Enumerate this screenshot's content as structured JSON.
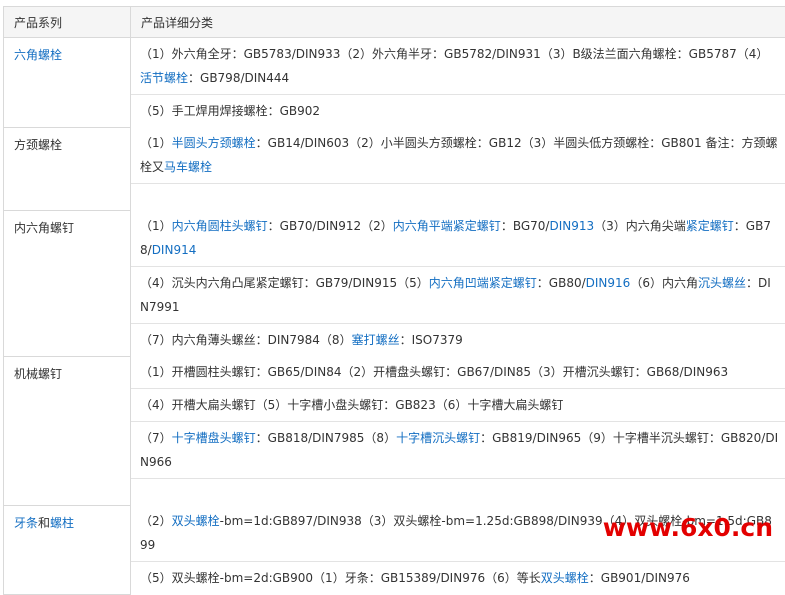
{
  "headers": {
    "series": "产品系列",
    "detail": "产品详细分类"
  },
  "rows": [
    {
      "label": "六角螺栓",
      "label_parts": [
        {
          "text": "六角螺栓",
          "link": true
        }
      ],
      "cells": [
        [
          {
            "t": "（1）外六角全牙：GB5783/DIN933（2）外六角半牙：GB5782/DIN931（3）B级法兰面六角螺栓：GB5787（4）",
            "l": false
          },
          {
            "t": "活节螺栓",
            "l": true
          },
          {
            "t": "：GB798/DIN444",
            "l": false
          }
        ],
        [
          {
            "t": "（5）手工焊用焊接螺栓：GB902",
            "l": false
          }
        ]
      ]
    },
    {
      "label": "方颈螺栓",
      "label_parts": [
        {
          "text": "方颈螺栓",
          "link": false
        }
      ],
      "cells": [
        [
          {
            "t": "（1）",
            "l": false
          },
          {
            "t": "半圆头方颈螺栓",
            "l": true
          },
          {
            "t": "：GB14/DIN603（2）小半圆头方颈螺栓：GB12（3）半圆头低方颈螺栓：GB801 备注：方颈螺栓又",
            "l": false
          },
          {
            "t": "马车螺栓",
            "l": true
          }
        ],
        []
      ]
    },
    {
      "label": "内六角螺钉",
      "label_parts": [
        {
          "text": "内六角螺钉",
          "link": false
        }
      ],
      "cells": [
        [
          {
            "t": "（1）",
            "l": false
          },
          {
            "t": "内六角圆柱头螺钉",
            "l": true
          },
          {
            "t": "：GB70/DIN912（2）",
            "l": false
          },
          {
            "t": "内六角平端紧定螺钉",
            "l": true
          },
          {
            "t": "：BG70/",
            "l": false
          },
          {
            "t": "DIN913",
            "l": true
          },
          {
            "t": "（3）内六角尖端",
            "l": false
          },
          {
            "t": "紧定螺钉",
            "l": true
          },
          {
            "t": "：GB78/",
            "l": false
          },
          {
            "t": "DIN914",
            "l": true
          }
        ],
        [
          {
            "t": "（4）沉头内六角凸尾紧定螺钉：GB79/DIN915（5）",
            "l": false
          },
          {
            "t": "内六角凹端紧定螺钉",
            "l": true
          },
          {
            "t": "：GB80/",
            "l": false
          },
          {
            "t": "DIN916",
            "l": true
          },
          {
            "t": "（6）内六角",
            "l": false
          },
          {
            "t": "沉头螺丝",
            "l": true
          },
          {
            "t": "：DIN7991",
            "l": false
          }
        ],
        [
          {
            "t": "（7）内六角薄头螺丝：DIN7984（8）",
            "l": false
          },
          {
            "t": "塞打螺丝",
            "l": true
          },
          {
            "t": "：ISO7379",
            "l": false
          }
        ]
      ]
    },
    {
      "label": "机械螺钉",
      "label_parts": [
        {
          "text": "机械螺钉",
          "link": false
        }
      ],
      "cells": [
        [
          {
            "t": "（1）开槽圆柱头螺钉：GB65/DIN84（2）开槽盘头螺钉：GB67/DIN85（3）开槽沉头螺钉：GB68/DIN963",
            "l": false
          }
        ],
        [
          {
            "t": "（4）开槽大扁头螺钉（5）十字槽小盘头螺钉：GB823（6）十字槽大扁头螺钉",
            "l": false
          }
        ],
        [
          {
            "t": "（7）",
            "l": false
          },
          {
            "t": "十字槽盘头螺钉",
            "l": true
          },
          {
            "t": "：GB818/DIN7985（8）",
            "l": false
          },
          {
            "t": "十字槽沉头螺钉",
            "l": true
          },
          {
            "t": "：GB819/DIN965（9）十字槽半沉头螺钉：GB820/DIN966",
            "l": false
          }
        ],
        []
      ]
    },
    {
      "label": "牙条和螺柱",
      "label_parts": [
        {
          "text": "牙条",
          "link": true
        },
        {
          "text": "和",
          "link": false
        },
        {
          "text": "螺柱",
          "link": true
        }
      ],
      "cells": [
        [
          {
            "t": "（2）",
            "l": false
          },
          {
            "t": "双头螺栓",
            "l": true
          },
          {
            "t": "-bm=1d:GB897/DIN938（3）双头螺栓-bm=1.25d:GB898/DIN939（4）双头螺栓-bm=1.5d:GB899",
            "l": false
          }
        ],
        [
          {
            "t": "（5）双头螺栓-bm=2d:GB900（1）牙条：GB15389/DIN976（6）等长",
            "l": false
          },
          {
            "t": "双头螺栓",
            "l": true
          },
          {
            "t": "：GB901/DIN976",
            "l": false
          }
        ]
      ]
    }
  ],
  "watermark": "www.6x0.cn"
}
